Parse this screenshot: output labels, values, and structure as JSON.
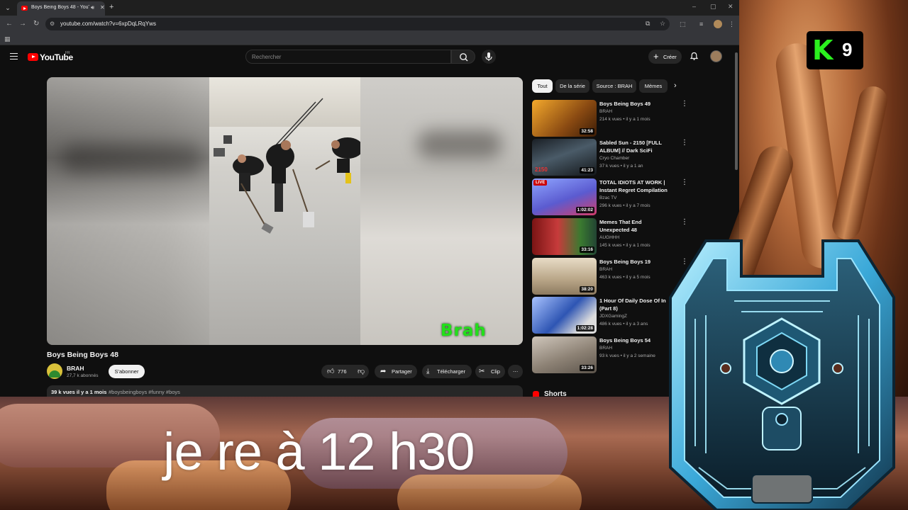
{
  "browser": {
    "tab_title": "Boys Being Boys 48 - YouTu",
    "tab_list_icon": "chevron-down-icon",
    "new_tab_label": "+",
    "window_controls": [
      "–",
      "▢",
      "✕"
    ],
    "url": "youtube.com/watch?v=6xpDqLRqYws"
  },
  "youtube": {
    "logo": "YouTube",
    "logo_sup": "FR",
    "search_placeholder": "Rechercher",
    "create_label": "Créer",
    "video": {
      "title": "Boys Being Boys 48",
      "watermark": "Brah",
      "channel": "BRAH",
      "subscribers": "27,7 k abonnés",
      "subscribe_label": "S'abonner",
      "likes": "776",
      "share_label": "Partager",
      "download_label": "Télécharger",
      "clip_label": "Clip",
      "description_meta": "39 k vues  il y a 1 mois",
      "description_tags": "#boysbeingboys #funny #boys"
    },
    "chips": [
      "Tout",
      "De la série",
      "Source : BRAH",
      "Mèmes"
    ],
    "recommendations": [
      {
        "title": "Boys Being Boys 49",
        "channel": "BRAH",
        "meta": "214 k vues • il y a 1 mois",
        "duration": "32:58",
        "thumb_color": "#8a4a12"
      },
      {
        "title": "Sabled Sun - 2150 [FULL ALBUM] // Dark SciFi Ambient",
        "channel": "Cryo Chamber",
        "meta": "37 k vues • il y a 1 an",
        "duration": "41:23",
        "badge": "2150",
        "thumb_color": "#20262d"
      },
      {
        "title": "TOTAL IDIOTS AT WORK | Instant Regret Compilation ...",
        "channel": "Bzac TV",
        "meta": "296 k vues • il y a 7 mois",
        "duration": "1:02:02",
        "live": "LIVE",
        "thumb_color": "#6d6fd6"
      },
      {
        "title": "Memes That End Unexpected 48",
        "channel": "AUGHHH",
        "meta": "145 k vues • il y a 1 mois",
        "duration": "33:16",
        "thumb_color": "#8a2323"
      },
      {
        "title": "Boys Being Boys 19",
        "channel": "BRAH",
        "meta": "463 k vues • il y a 5 mois",
        "duration": "38:20",
        "thumb_color": "#c9b79a"
      },
      {
        "title": "1 Hour Of Daily Dose Of In (Part 8)",
        "channel": "JDXGamingZ",
        "meta": "486 k vues • il y a 3 ans",
        "duration": "1:02:28",
        "thumb_color": "#3a5ea8"
      },
      {
        "title": "Boys Being Boys 54",
        "channel": "BRAH",
        "meta": "93 k vues • il y a 2 semaine",
        "duration": "33:26",
        "thumb_color": "#9b8f84"
      }
    ],
    "shorts_label": "Shorts"
  },
  "overlay": {
    "logo_k": "K",
    "logo_9": "9",
    "caption": "je re à 12 h30"
  }
}
